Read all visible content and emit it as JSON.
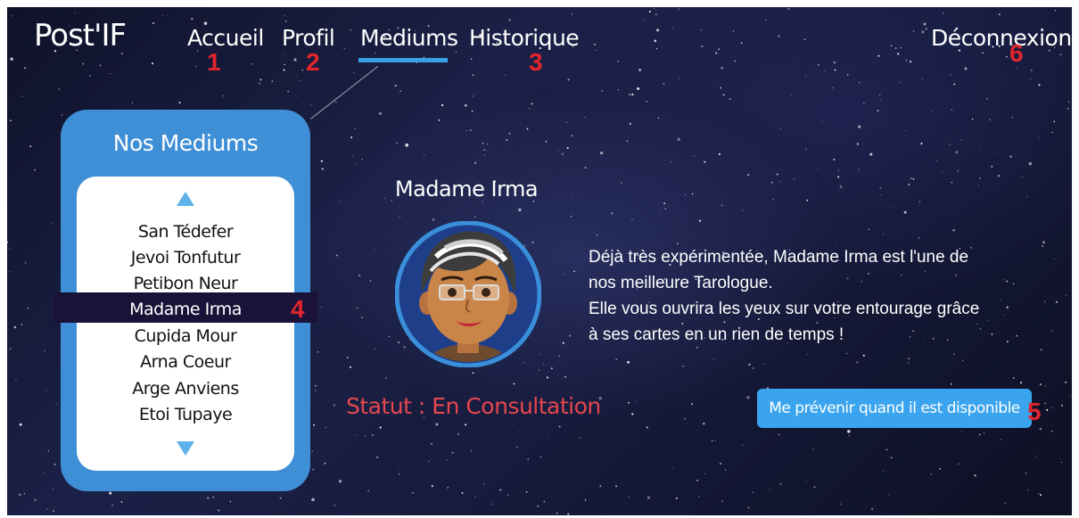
{
  "header": {
    "brand": "Post'IF",
    "nav": {
      "accueil": "Accueil",
      "profil": "Profil",
      "mediums": "Mediums",
      "historique": "Historique",
      "deconnexion": "Déconnexion"
    },
    "active_tab": "Mediums"
  },
  "markers": [
    "1",
    "2",
    "3",
    "4",
    "5",
    "6"
  ],
  "mediums_panel": {
    "title": "Nos Mediums",
    "up_icon": "triangle-up-icon",
    "down_icon": "triangle-down-icon",
    "items": [
      "San Tédefer",
      "Jevoi Tonfutur",
      "Petibon Neur",
      "Madame Irma",
      "Cupida Mour",
      "Arna Coeur",
      "Arge Anviens",
      "Etoi Tupaye"
    ],
    "selected": "Madame Irma"
  },
  "medium_detail": {
    "name": "Madame Irma",
    "avatar_icon": "medium-avatar-icon",
    "status": "Statut : En Consultation",
    "description": [
      "Déjà très expérimentée, Madame Irma est l'une de",
      "nos meilleure Tarologue.",
      "Elle vous ouvrira les yeux sur votre entourage grâce",
      "à ses cartes en un rien de temps !"
    ],
    "notify_button": "Me prévenir quand il est disponible"
  },
  "colors": {
    "accent": "#3aa0e6",
    "panel": "#3f8fd6",
    "selection": "#1a1238",
    "status": "#e6474f",
    "marker": "#e0262c"
  }
}
